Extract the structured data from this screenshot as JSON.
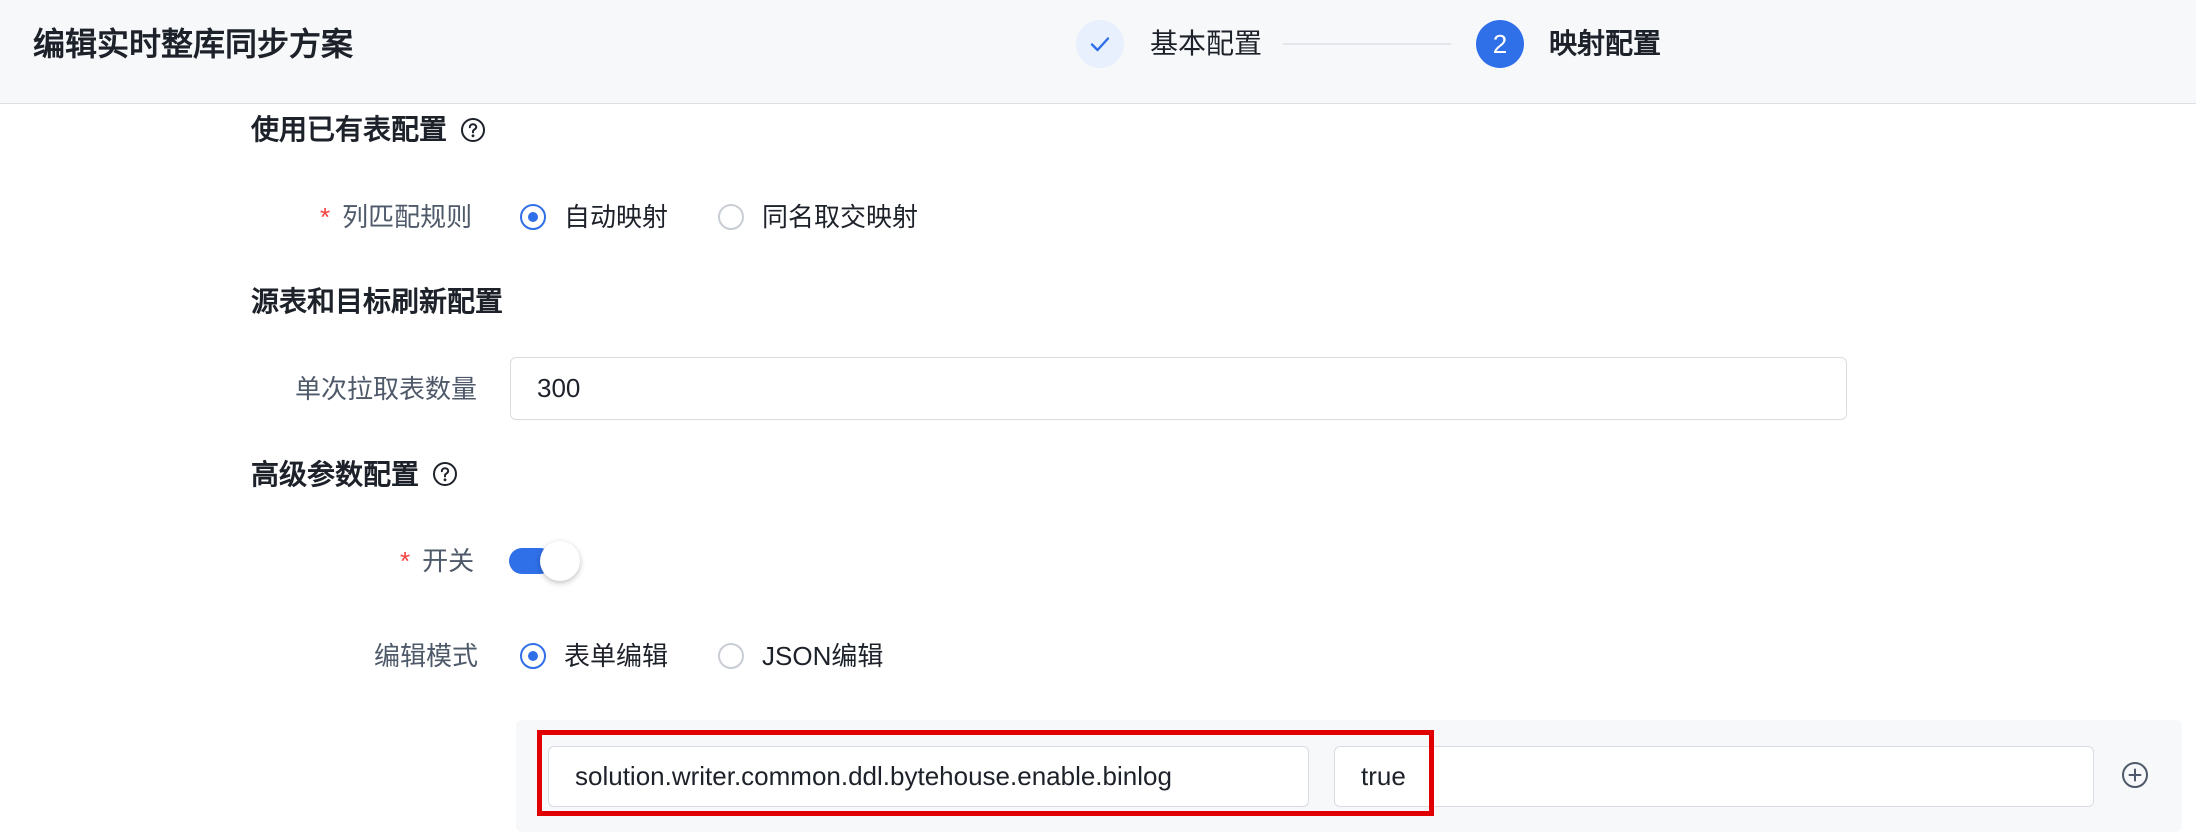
{
  "header": {
    "title": "编辑实时整库同步方案",
    "steps": [
      {
        "label": "基本配置",
        "status": "done"
      },
      {
        "label": "映射配置",
        "number": "2",
        "status": "active"
      }
    ]
  },
  "sections": {
    "existing_table": {
      "title": "使用已有表配置",
      "column_rule": {
        "label": "列匹配规则",
        "required": "*",
        "options": [
          "自动映射",
          "同名取交映射"
        ],
        "selected": "自动映射"
      }
    },
    "refresh": {
      "title": "源表和目标刷新配置",
      "batch_size": {
        "label": "单次拉取表数量",
        "value": "300"
      }
    },
    "advanced": {
      "title": "高级参数配置",
      "switch": {
        "label": "开关",
        "required": "*",
        "value": "on"
      },
      "edit_mode": {
        "label": "编辑模式",
        "options": [
          "表单编辑",
          "JSON编辑"
        ],
        "selected": "表单编辑"
      },
      "params": [
        {
          "key": "solution.writer.common.ddl.bytehouse.enable.binlog",
          "value": "true"
        }
      ]
    }
  },
  "colors": {
    "primary": "#2f6fe8",
    "required": "#f53f3f",
    "highlight": "#e00000",
    "header_bg": "#f7f8fa"
  },
  "icons": [
    "check-icon",
    "help-icon",
    "add-circle-icon"
  ]
}
